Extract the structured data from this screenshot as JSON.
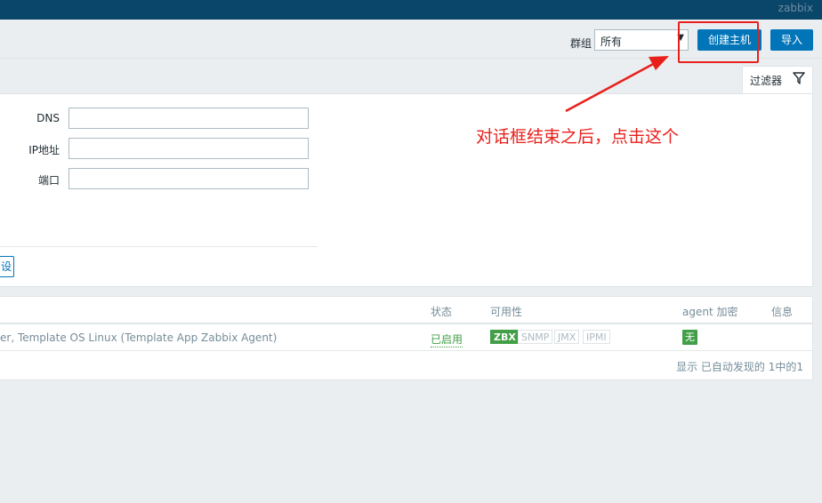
{
  "topbar": {
    "brand": "zabbix",
    "color": "#0a466a"
  },
  "header": {
    "group_label": "群组",
    "group_select_value": "所有",
    "create_host_label": "创建主机",
    "import_label": "导入"
  },
  "filter": {
    "tab_label": "过滤器",
    "dns_label": "DNS",
    "ip_label": "IP地址",
    "port_label": "端口",
    "dns_value": "",
    "ip_value": "",
    "port_value": "",
    "reset_label": "设"
  },
  "annotation": {
    "text": "对话框结束之后，点击这个",
    "color": "#e8201c"
  },
  "table": {
    "columns": {
      "status": "状态",
      "availability": "可用性",
      "agent_encryption": "agent 加密",
      "info": "信息"
    },
    "rows": [
      {
        "templates": "er, Template OS Linux (Template App Zabbix Agent)",
        "status": "已启用",
        "availability": [
          "ZBX",
          "SNMP",
          "JMX",
          "IPMI"
        ],
        "encryption": "无"
      }
    ],
    "footer": "显示 已自动发现的 1中的1"
  }
}
